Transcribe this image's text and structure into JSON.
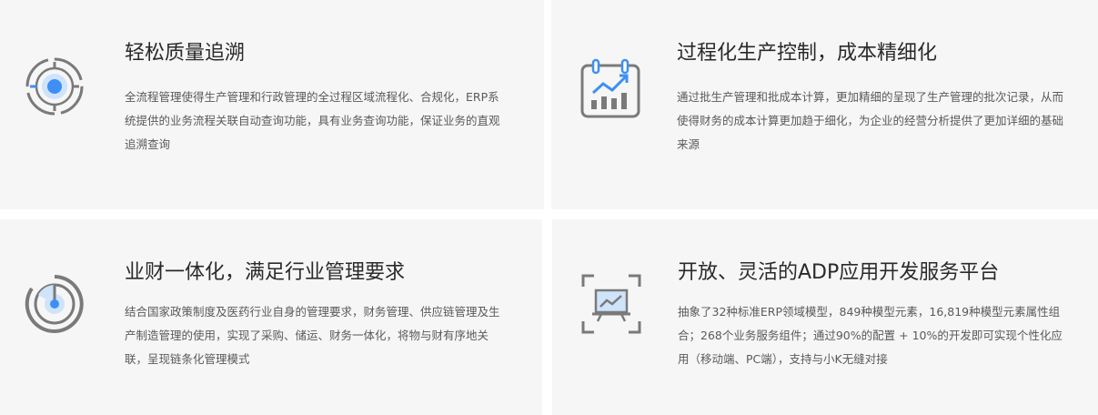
{
  "features": [
    {
      "title": "轻松质量追溯",
      "desc": "全流程管理使得生产管理和行政管理的全过程区域流程化、合规化，ERP系统提供的业务流程关联自动查询功能，具有业务查询功能，保证业务的直观追溯查询",
      "icon": "target-icon"
    },
    {
      "title": "过程化生产控制，成本精细化",
      "desc": "通过批生产管理和批成本计算，更加精细的呈现了生产管理的批次记录，从而使得财务的成本计算更加趋于细化，为企业的经营分析提供了更加详细的基础来源",
      "icon": "calendar-chart-icon"
    },
    {
      "title": "业财一体化，满足行业管理要求",
      "desc": "结合国家政策制度及医药行业自身的管理要求，财务管理、供应链管理及生产制造管理的使用，实现了采购、储运、财务一体化，将物与财有序地关联，呈现链条化管理模式",
      "icon": "radar-icon"
    },
    {
      "title": "开放、灵活的ADP应用开发服务平台",
      "desc": "抽象了32种标准ERP领域模型，849种模型元素，16,819种模型元素属性组合；268个业务服务组件；通过90%的配置 + 10%的开发即可实现个性化应用（移动端、PC端），支持与小K无缝对接",
      "icon": "presentation-icon"
    }
  ],
  "colors": {
    "accent": "#3d8ff5",
    "icon_gray": "#7a7a7a",
    "card_bg": "#f6f6f6"
  }
}
